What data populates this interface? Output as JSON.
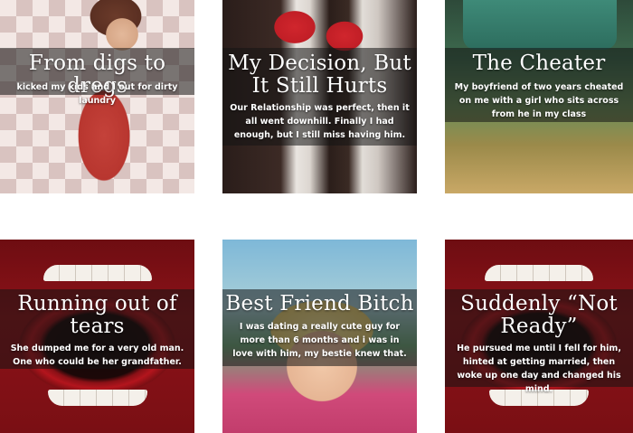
{
  "cards": [
    {
      "title": "From digs to dregs",
      "description": "kicked my kids and I out for dirty laundry"
    },
    {
      "title": "My Decision, But It Still Hurts",
      "description": "Our Relationship was perfect, then it all went downhill. Finally I had enough, but I still miss having him."
    },
    {
      "title": "The Cheater",
      "description": "My boyfriend of two years cheated on me with a girl who sits across from he in my class"
    },
    {
      "title": "Running out of tears",
      "description": "She dumped me for a very old man. One who could be her grandfather."
    },
    {
      "title": "Best Friend Bitch",
      "description": "I was dating a really cute guy for more than 6 months and i was in love with him, my bestie knew that."
    },
    {
      "title": "Suddenly “Not Ready”",
      "description": "He pursued me until I fell for him, hinted at getting married, then woke up one day and changed his mind."
    }
  ],
  "colors": {
    "overlay": "#141414",
    "text": "#ffffff",
    "mouth_red": "#8c1218"
  }
}
